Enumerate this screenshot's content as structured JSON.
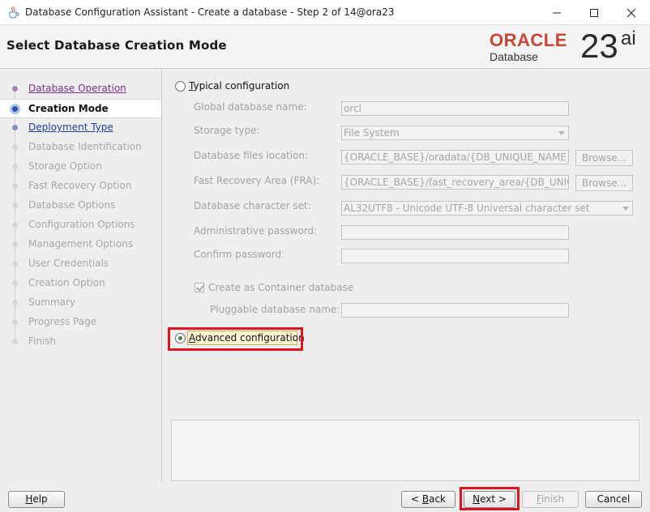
{
  "window": {
    "title": "Database Configuration Assistant - Create a database - Step 2 of 14@ora23",
    "app_icon": "java-cup-icon",
    "controls": [
      "minimize-icon",
      "maximize-icon",
      "close-icon"
    ]
  },
  "header": {
    "title": "Select Database Creation Mode",
    "logo": {
      "brand": "ORACLE",
      "product": "Database",
      "version": "23",
      "suffix": "ai",
      "brand_color": "#c74634"
    }
  },
  "nav": {
    "items": [
      {
        "label": "Database Operation",
        "state": "visited"
      },
      {
        "label": "Creation Mode",
        "state": "current"
      },
      {
        "label": "Deployment Type",
        "state": "link"
      },
      {
        "label": "Database Identification",
        "state": "disabled"
      },
      {
        "label": "Storage Option",
        "state": "disabled"
      },
      {
        "label": "Fast Recovery Option",
        "state": "disabled"
      },
      {
        "label": "Database Options",
        "state": "disabled"
      },
      {
        "label": "Configuration Options",
        "state": "disabled"
      },
      {
        "label": "Management Options",
        "state": "disabled"
      },
      {
        "label": "User Credentials",
        "state": "disabled"
      },
      {
        "label": "Creation Option",
        "state": "disabled"
      },
      {
        "label": "Summary",
        "state": "disabled"
      },
      {
        "label": "Progress Page",
        "state": "disabled"
      },
      {
        "label": "Finish",
        "state": "disabled"
      }
    ]
  },
  "main": {
    "typical": {
      "label_pre": "",
      "label_mn": "T",
      "label_post": "ypical configuration",
      "selected": false
    },
    "fields": {
      "global_db_name": {
        "label": "Global database name:",
        "value": "orcl"
      },
      "storage_type": {
        "label": "Storage type:",
        "value": "File System"
      },
      "db_files_location": {
        "label": "Database files location:",
        "value": "{ORACLE_BASE}/oradata/{DB_UNIQUE_NAME}",
        "browse": "Browse..."
      },
      "fra": {
        "label": "Fast Recovery Area (FRA):",
        "value": "{ORACLE_BASE}/fast_recovery_area/{DB_UNIQUE_NAME}",
        "browse": "Browse..."
      },
      "charset": {
        "label": "Database character set:",
        "value": "AL32UTF8 - Unicode UTF-8 Universal character set"
      },
      "admin_password": {
        "label": "Administrative password:",
        "value": ""
      },
      "confirm_password": {
        "label": "Confirm password:",
        "value": ""
      },
      "container_db": {
        "label": "Create as Container database",
        "checked": true
      },
      "pdb_name": {
        "label": "Pluggable database name:",
        "value": ""
      }
    },
    "advanced": {
      "label_pre": "",
      "label_mn": "A",
      "label_post": "dvanced configuration",
      "selected": true
    },
    "message": ""
  },
  "buttons": {
    "help": {
      "mn": "H",
      "rest": "elp"
    },
    "back": {
      "pre": "< ",
      "mn": "B",
      "rest": "ack"
    },
    "next": {
      "mn": "N",
      "rest": "ext >"
    },
    "finish": {
      "mn": "F",
      "rest": "inish",
      "disabled": true
    },
    "cancel": {
      "label": "Cancel"
    }
  },
  "colors": {
    "highlight": "#e0141e",
    "link": "#1f3f9a",
    "visited": "#7a2f8a"
  }
}
